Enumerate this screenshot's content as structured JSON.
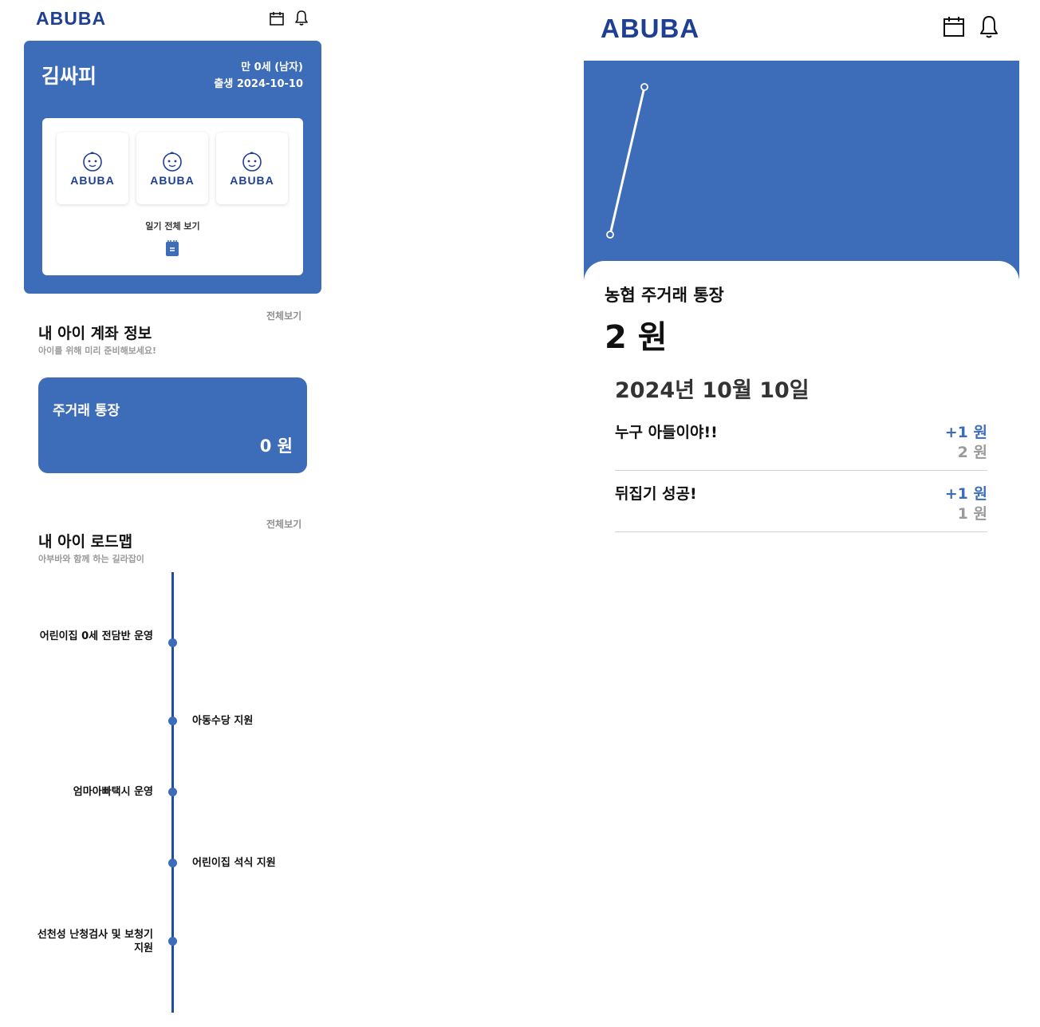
{
  "left_screen": {
    "header": {
      "logo": "ABUBA",
      "icons": [
        "calendar-icon",
        "bell-icon"
      ]
    },
    "profile": {
      "name": "김싸피",
      "age": "만 0세 (남자)",
      "birth": "출생 2024-10-10"
    },
    "diary": {
      "thumbnails": [
        "ABUBA",
        "ABUBA",
        "ABUBA"
      ],
      "view_all_label": "일기 전체 보기",
      "icon": "notepad-icon"
    },
    "account_section": {
      "title": "내 아이 계좌 정보",
      "subtitle": "아이를 위해 미리 준비해보세요!",
      "see_all": "전체보기",
      "card": {
        "name": "주거래 통장",
        "balance": "0 원"
      }
    },
    "roadmap_section": {
      "title": "내 아이 로드맵",
      "subtitle": "아부바와 함께 하는 길라잡이",
      "see_all": "전체보기",
      "items": [
        {
          "label": "어린이집 0세 전담반 운영",
          "side": "left"
        },
        {
          "label": "아동수당 지원",
          "side": "right"
        },
        {
          "label": "엄마아빠택시 운영",
          "side": "left"
        },
        {
          "label": "어린이집 석식 지원",
          "side": "right"
        },
        {
          "label": "선천성 난청검사 및 보청기 지원",
          "side": "left"
        }
      ]
    }
  },
  "right_screen": {
    "header": {
      "logo": "ABUBA",
      "icons": [
        "calendar-icon",
        "bell-icon"
      ]
    },
    "chart_data": {
      "type": "line",
      "x": [
        1,
        2
      ],
      "y": [
        1,
        2
      ],
      "line_color": "#ffffff",
      "background": "#3d6cb9"
    },
    "account": {
      "name": "농협 주거래 통장",
      "balance": "2 원"
    },
    "date": "2024년 10월 10일",
    "transactions": [
      {
        "title": "누구 아들이야!!",
        "amount": "+1 원",
        "balance": "2 원"
      },
      {
        "title": "뒤집기 성공!",
        "amount": "+1 원",
        "balance": "1 원"
      }
    ]
  },
  "colors": {
    "primary": "#3d6cb9",
    "logo": "#1f3f95",
    "timeline": "#1f4da0",
    "muted": "#9a9a9a"
  }
}
